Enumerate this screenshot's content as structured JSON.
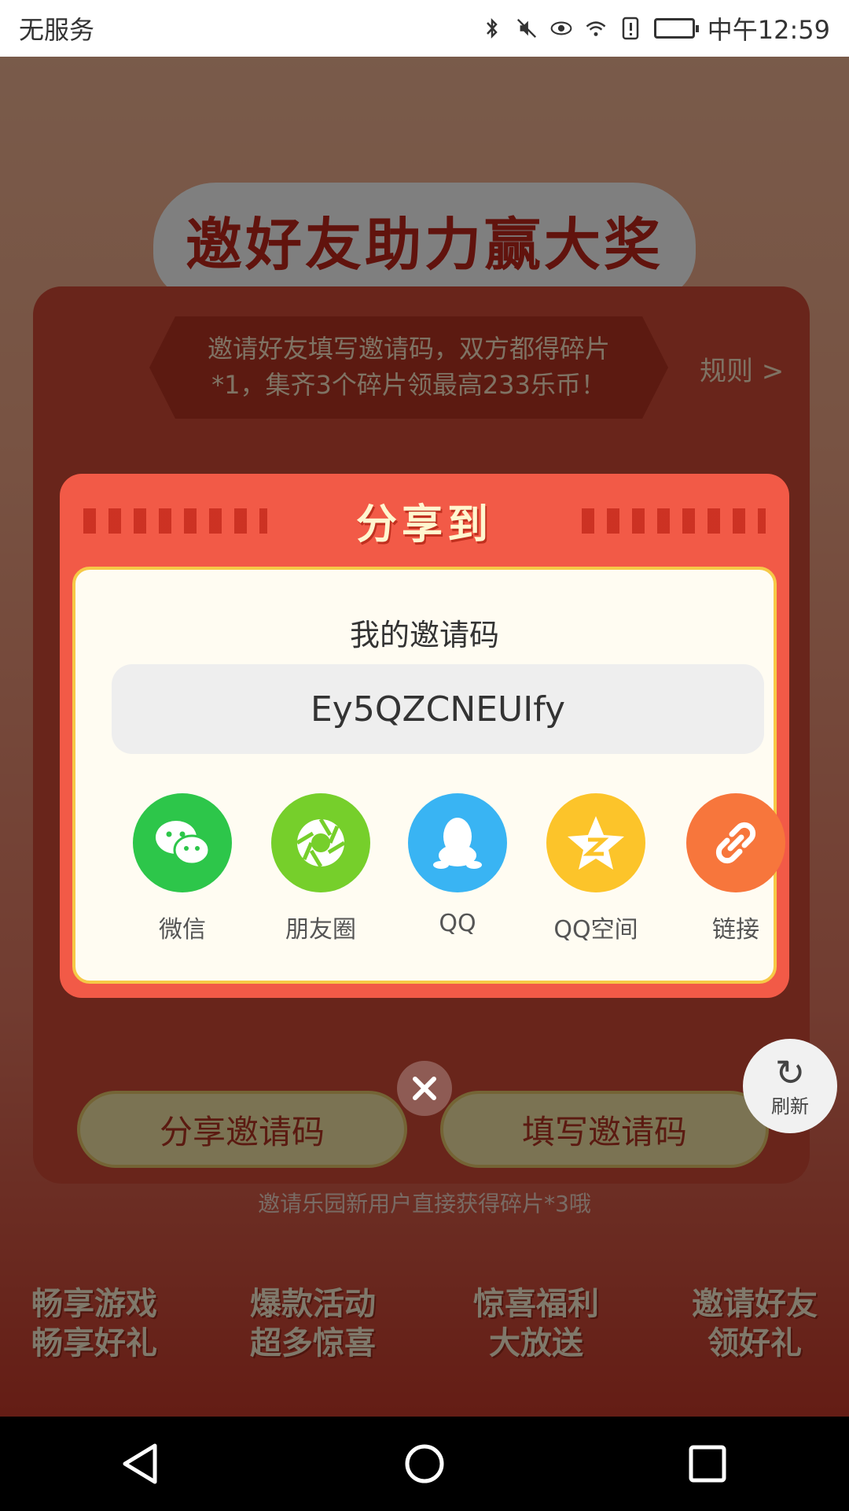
{
  "status_bar": {
    "carrier": "无服务",
    "time": "中午12:59"
  },
  "page": {
    "title": "邀好友助力赢大奖",
    "banner_line1": "邀请好友填写邀请码，双方都得碎片",
    "banner_line2": "*1，集齐3个碎片领最高233乐币！",
    "rules_link": "规则 >",
    "share_code_button": "分享邀请码",
    "enter_code_button": "填写邀请码",
    "hint": "邀请乐园新用户直接获得碎片*3哦",
    "refresh_label": "刷新",
    "promos": [
      {
        "line1": "畅享游戏",
        "line2": "畅享好礼"
      },
      {
        "line1": "爆款活动",
        "line2": "超多惊喜"
      },
      {
        "line1": "惊喜福利",
        "line2": "大放送"
      },
      {
        "line1": "邀请好友",
        "line2": "领好礼"
      }
    ]
  },
  "modal": {
    "title": "分享到",
    "code_label": "我的邀请码",
    "invite_code": "Ey5QZCNEUIfy",
    "share_options": [
      {
        "label": "微信",
        "icon": "wechat-icon",
        "color": "#2dc64a"
      },
      {
        "label": "朋友圈",
        "icon": "moments-icon",
        "color": "#76cf2b"
      },
      {
        "label": "QQ",
        "icon": "qq-icon",
        "color": "#39b4f3"
      },
      {
        "label": "QQ空间",
        "icon": "qzone-icon",
        "color": "#fcc42a"
      },
      {
        "label": "链接",
        "icon": "link-icon",
        "color": "#f7763c"
      }
    ]
  }
}
